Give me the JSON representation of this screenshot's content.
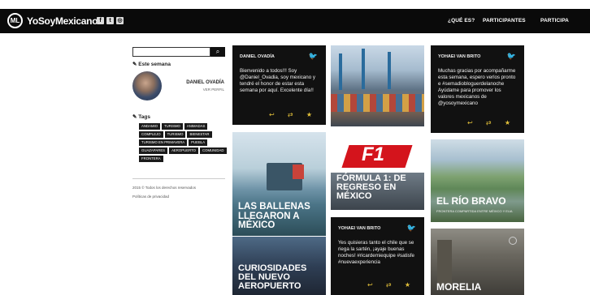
{
  "header": {
    "logo_mark": "ML",
    "logo_text": "YoSoyMexicano",
    "social_icons": [
      "facebook-icon",
      "twitter-icon",
      "instagram-icon"
    ],
    "nav": [
      "¿QUÉ ES?",
      "PARTICIPANTES",
      "PARTICIPA"
    ]
  },
  "sidebar": {
    "search_button": "⌕",
    "author_heading": "✎ Este semana",
    "author_name": "DANIEL OVADÍA",
    "author_sub": "VER PERFIL",
    "tags_heading": "✎ Tags",
    "tags": [
      "ANDAMIO",
      "TURISMO",
      "ANIMADAS",
      "COMPLEJO",
      "TURISMO",
      "BIENESTAR",
      "TURISMO EN PRIMAVERA",
      "PUEBLA",
      "GUAZAPARES",
      "AEROPUERTO",
      "COMUNIDAD",
      "FRONTERA"
    ],
    "note_1": "2015 © Todos los derechos reservados",
    "note_2": "Políticas de privacidad"
  },
  "cards": {
    "tweet_1": {
      "handle": "DANIEL OVADÍA",
      "body": "Bienvenido a todos!!! Soy @Daniel_Ovadia, soy mexicano y tendré el honor de estar esta semana por aquí. Excelente día!!"
    },
    "tweet_2": {
      "handle": "YOHAEI VAN BRITO",
      "body": "Muchas gracias por acompañarme esta semana, espero verlos pronto e #semadiobloguerdelanoche Ayúdame para promover los valores mexicanos de @yosoymexicano"
    },
    "tweet_3": {
      "handle": "YOHAEI VAN BRITO",
      "body": "Yes quisieras tanto el chile que se riega la sartén, ¡ayaje buenas noches! #ricardemiequipe #satisfe #nuevaexperiencia"
    },
    "ballenas": {
      "title": "LAS BALLENAS LLEGARON A MÉXICO"
    },
    "formula": {
      "title": "FÓRMULA 1: DE REGRESO EN MÉXICO",
      "logo": "F1"
    },
    "rio": {
      "title": "EL RÍO BRAVO",
      "sub": "FRONTERA COMPARTIDA ENTRE MÉXICO Y EUA"
    },
    "aeropuerto": {
      "title": "CURIOSIDADES DEL NUEVO AEROPUERTO"
    },
    "morelia": {
      "title": "MORELIA"
    },
    "action_icons": "↩ ⇄ ★"
  }
}
